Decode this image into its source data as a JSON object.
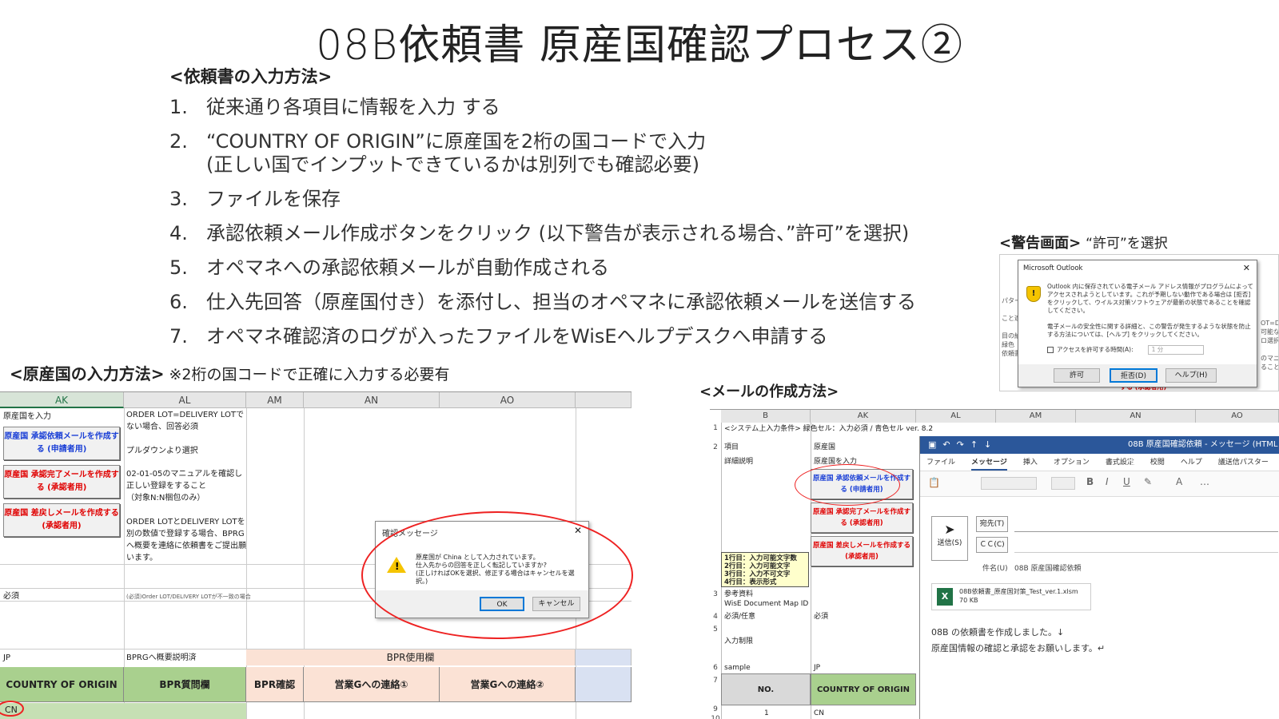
{
  "title": "08B依頼書 原産国確認プロセス②",
  "input_method": {
    "heading": "<依頼書の入力方法>",
    "steps": [
      {
        "num": "1.",
        "text": "従来通り各項目に情報を入力 する"
      },
      {
        "num": "2.",
        "text": "“COUNTRY OF ORIGIN”に原産国を2桁の国コードで入力\n(正しい国でインプットできているかは別列でも確認必要)"
      },
      {
        "num": "3.",
        "text": "ファイルを保存"
      },
      {
        "num": "4.",
        "text": "承認依頼メール作成ボタンをクリック (以下警告が表示される場合、”許可”を選択)"
      },
      {
        "num": "5.",
        "text": "オペマネへの承認依頼メールが自動作成される"
      },
      {
        "num": "6.",
        "text": "仕入先回答（原産国付き）を添付し、担当のオペマネに承認依頼メールを送信する"
      },
      {
        "num": "7.",
        "text": "オペマネ確認済のログが入ったファイルをWisEヘルプデスクへ申請する"
      }
    ]
  },
  "warning_section": {
    "heading": "<警告画面>",
    "note": "“許可”を選択",
    "dialog": {
      "title": "Microsoft Outlook",
      "message1": "Outlook 内に保存されている電子メール アドレス情報がプログラムによってアクセスされようとしています。これが予期しない動作である場合は [拒否] をクリックして、ウイルス対策ソフトウェアが最新の状態であることを確認してください。",
      "message2": "電子メールの安全性に関する詳細と、この警告が発生するような状態を防止する方法については、[ヘルプ] をクリックしてください。",
      "checkbox_label": "アクセスを許可する時間(A):",
      "duration": "1 分",
      "allow": "許可",
      "deny": "拒否(D)",
      "help": "ヘルプ(H)",
      "side_left": [
        "パター",
        "こと適",
        "目の納",
        "緑色",
        "依頼書"
      ],
      "side_right": [
        "OT=D",
        "可能な",
        "ロ選択",
        "のマニ",
        "ること"
      ],
      "bottom_btn": "する (承認者用)"
    }
  },
  "origin_section": {
    "heading": "<原産国の入力方法>",
    "note": "※2桁の国コードで正確に入力する必要有",
    "columns": [
      "AK",
      "AL",
      "AM",
      "AN",
      "AO"
    ],
    "ak_label": "原産国を入力",
    "al_text1": "ORDER LOT=DELIVERY LOTでない場合、回答必須",
    "al_text2": "プルダウンより選択",
    "al_text3": "02-01-05のマニュアルを確認し正しい登録をすること\n（対象N:N梱包のみ）",
    "al_text4": "ORDER LOTとDELIVERY LOTを別の数値で登録する場合、BPRGへ概要を連絡に依頼書をご提出願います。",
    "buttons": [
      {
        "label": "原産国 承認依頼メールを作成する (申請者用)",
        "color": "blue"
      },
      {
        "label": "原産国 承認完了メールを作成する (承認者用)",
        "color": "red"
      },
      {
        "label": "原産国 差戻しメールを作成する (承認者用)",
        "color": "red"
      }
    ],
    "required": "必須",
    "required_note": "(必須)Order LOT/DELIVERY LOTが不一致の場合",
    "jp": "JP",
    "bprg_note": "BPRGへ概要説明済",
    "bpr_band": "BPR使用欄",
    "headers": [
      "COUNTRY OF ORIGIN",
      "BPR質問欄",
      "BPR確認",
      "営業Gへの連絡①",
      "営業Gへの連絡②"
    ],
    "value": "CN",
    "dialog": {
      "title": "確認メッセージ",
      "message": "原産国が China として入力されています。\n仕入先からの回答を正しく転記していますか?\n(正しければOKを選択、修正する場合はキャンセルを選択。)",
      "ok": "OK",
      "cancel": "キャンセル"
    }
  },
  "mail_section": {
    "heading": "<メールの作成方法>",
    "columns": [
      "B",
      "AK",
      "AL",
      "AM",
      "AN",
      "AO"
    ],
    "row1": "<システム上入力条件> 緑色セル：入力必須 / 青色セル ver. 8.2",
    "item": "項目",
    "origin": "原産国",
    "detail": "詳細説明",
    "input_origin": "原産国を入力",
    "yellow_note": "1行目：入力可能文字数\n2行目：入力可能文字\n3行目：入力不可文字\n4行目：表示形式",
    "ref1": "参考資料",
    "ref2": "WisE Document Map ID",
    "required_opt": "必須/任意",
    "required": "必須",
    "input_limit": "入力制限",
    "sample": "sample",
    "jp": "JP",
    "no_hdr": "NO.",
    "coo_hdr": "COUNTRY OF ORIGIN",
    "row10_no": "1",
    "row10_val": "CN",
    "row_numbers": [
      "1",
      "2",
      "3",
      "4",
      "5",
      "6",
      "7",
      "9",
      "10"
    ],
    "buttons": [
      {
        "label": "原産国 承認依頼メールを作成する (申請者用)",
        "color": "blue"
      },
      {
        "label": "原産国 承認完了メールを作成する (承認者用)",
        "color": "red"
      },
      {
        "label": "原産国 差戻しメールを作成する (承認者用)",
        "color": "red"
      }
    ],
    "outlook": {
      "window_title": "08B 原産国確認依頼 - メッセージ (HTML 形式)",
      "tabs": [
        "ファイル",
        "メッセージ",
        "挿入",
        "オプション",
        "書式設定",
        "校閲",
        "ヘルプ",
        "議送信パスター"
      ],
      "active_tab": "メッセージ",
      "send": "送信(S)",
      "to": "宛先(T)",
      "cc": "ＣＣ(C)",
      "subject_label": "件名(U)",
      "subject": "08B 原産国確認依頼",
      "attachment_name": "08B依頼書_原産国対策_Test_ver.1.xlsm",
      "attachment_size": "70 KB",
      "body": "08B の依頼書を作成しました。↓\n原産国情報の確認と承認をお願いします。↵"
    }
  }
}
